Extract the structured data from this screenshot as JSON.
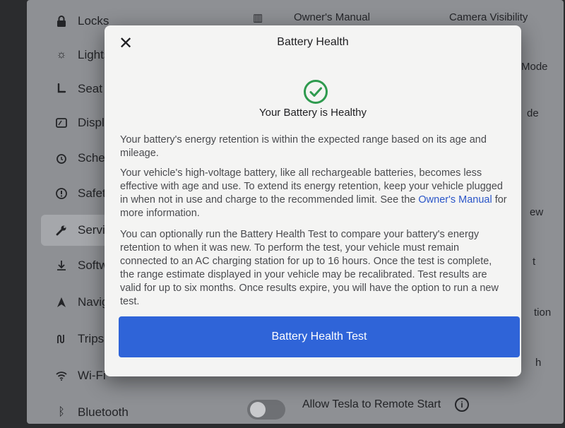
{
  "sidebar": {
    "items": [
      {
        "label": "Locks",
        "icon": "lock-icon"
      },
      {
        "label": "Lights",
        "icon": "light-icon"
      },
      {
        "label": "Seat",
        "icon": "seat-icon"
      },
      {
        "label": "Display",
        "icon": "display-icon"
      },
      {
        "label": "Schedule",
        "icon": "schedule-icon"
      },
      {
        "label": "Safety",
        "icon": "safety-icon"
      },
      {
        "label": "Service",
        "icon": "wrench-icon"
      },
      {
        "label": "Software",
        "icon": "download-icon"
      },
      {
        "label": "Navigation",
        "icon": "navigation-icon"
      },
      {
        "label": "Trips",
        "icon": "trips-icon"
      },
      {
        "label": "Wi-Fi",
        "icon": "wifi-icon"
      },
      {
        "label": "Bluetooth",
        "icon": "bluetooth-icon"
      }
    ]
  },
  "background": {
    "owners_manual": "Owner's Manual",
    "camera_visibility": "Camera Visibility",
    "mode_fragment": "Mode",
    "de_fragment": "de",
    "ew_fragment": "ew",
    "t_fragment": "t",
    "tion_fragment": "tion",
    "h_fragment": "h",
    "allow_remote_start": "Allow Tesla to Remote Start"
  },
  "modal": {
    "title": "Battery Health",
    "status": "Your Battery is Healthy",
    "para1": "Your battery's energy retention is within the expected range based on its age and mileage.",
    "para2_before": "Your vehicle's high-voltage battery, like all rechargeable batteries, becomes less effective with age and use. To extend its energy retention, keep your vehicle plugged in when not in use and charge to the recommended limit. See the ",
    "para2_link": "Owner's Manual",
    "para2_after": " for more information.",
    "para3": "You can optionally run the Battery Health Test to compare your battery's energy retention to when it was new. To perform the test, your vehicle must remain connected to an AC charging station for up to 16 hours. Once the test is complete, the range estimate displayed in your vehicle may be recalibrated. Test results are valid for up to six months. Once results expire, you will have the option to run a new test.",
    "button_label": "Battery Health Test"
  },
  "colors": {
    "accent": "#2f64d8",
    "success": "#2e9a4e",
    "link": "#2a55c8"
  }
}
